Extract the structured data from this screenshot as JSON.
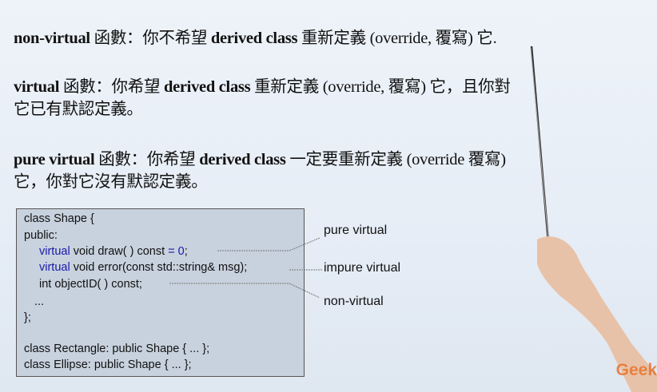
{
  "slide": {
    "lines": [
      {
        "term": "non-virtual",
        "text": " 函數：你不希望 ",
        "term2": "derived class",
        "text2": " 重新定義 (override, 覆寫) 它."
      },
      {
        "term": "virtual",
        "text": " 函數：你希望 ",
        "term2": "derived class",
        "text2": " 重新定義 (override, 覆寫) 它，且你對"
      },
      {
        "text": "它已有默認定義。"
      },
      {
        "term": "pure virtual",
        "text": " 函數：你希望 ",
        "term2": "derived class",
        "text2": " 一定要重新定義 (override 覆寫)"
      },
      {
        "text": "它，你對它沒有默認定義。"
      }
    ],
    "code": {
      "l1": "class Shape {",
      "l2": "public:",
      "l3_kw": "virtual",
      "l3": " void draw( ) const ",
      "l3_eq": "= 0",
      ";": ";",
      "l4_kw": "virtual",
      "l4": " void error(const std::string& msg);",
      "l5": "int objectID( ) const;",
      "l6": "...",
      "l7": "};",
      "l8": "class Rectangle: public Shape { ... };",
      "l9": "class Ellipse: public Shape { ... };"
    },
    "labels": {
      "pure": "pure virtual",
      "impure": "impure virtual",
      "non": "non-virtual"
    },
    "keyword_color": "#1a1aa8"
  },
  "watermark": "Geek"
}
